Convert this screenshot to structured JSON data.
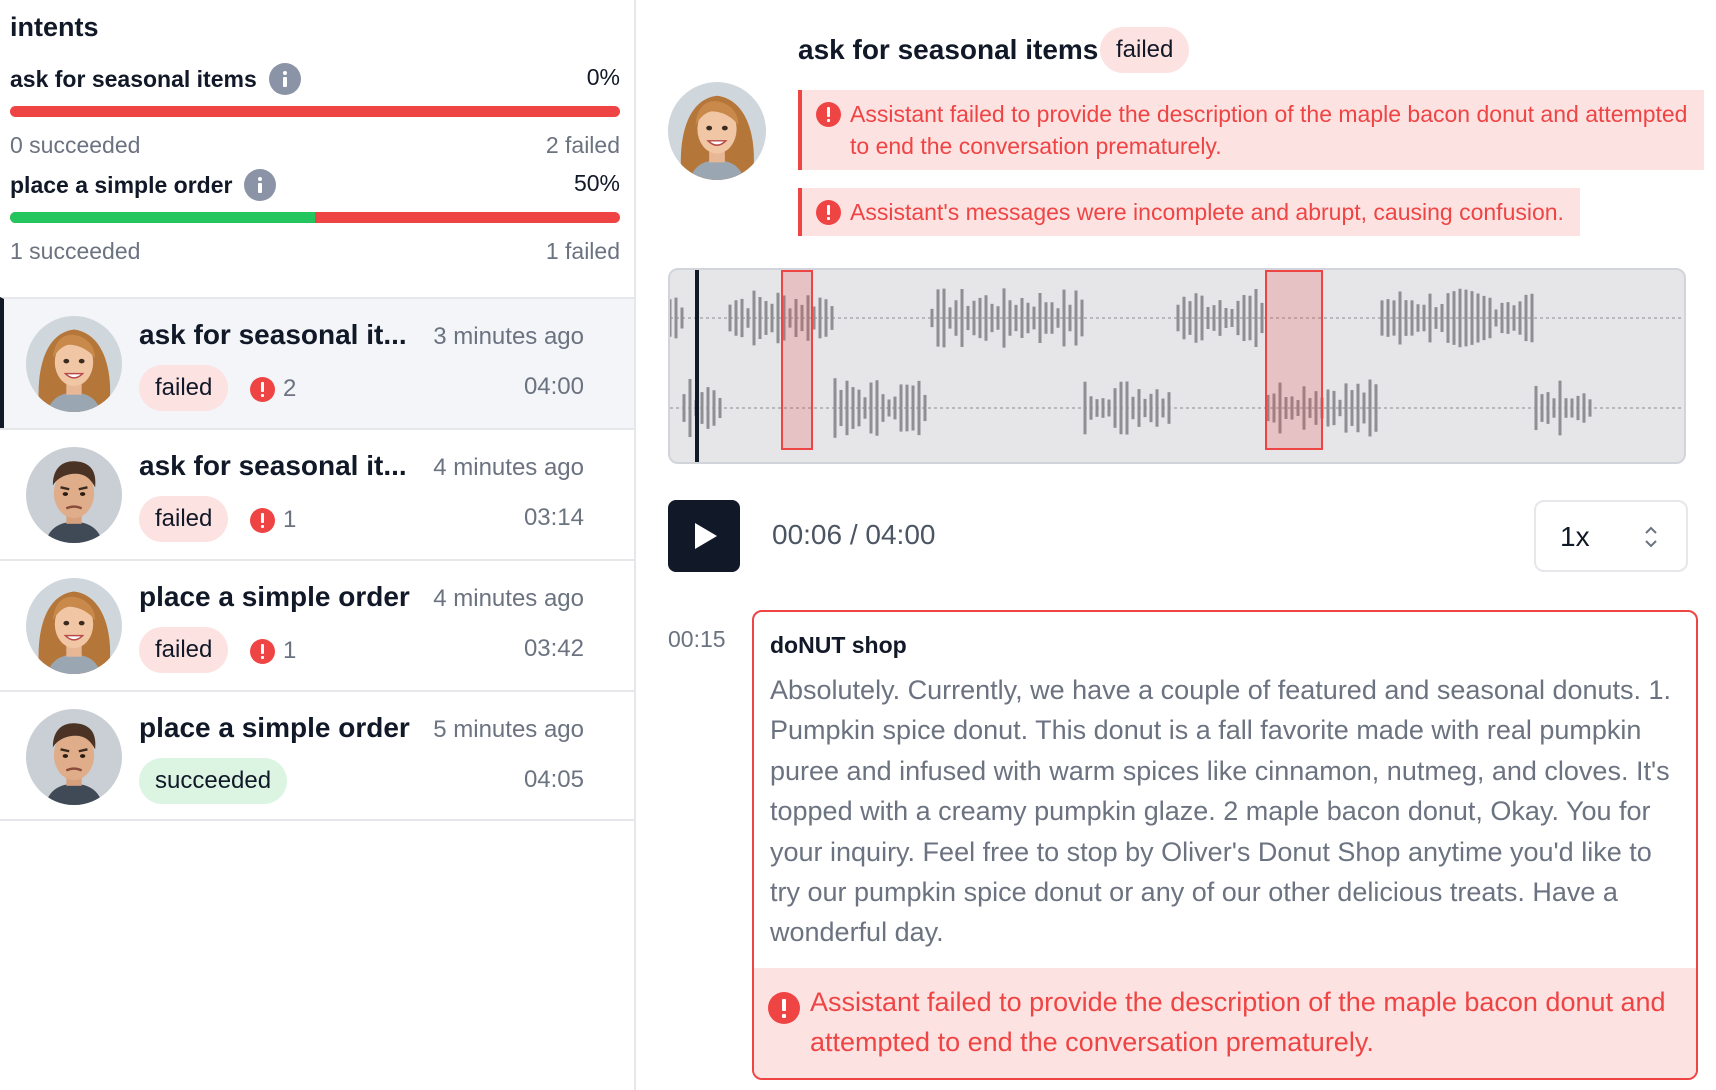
{
  "intents": {
    "title": "intents",
    "items": [
      {
        "name": "ask for seasonal items",
        "percent": "0%",
        "success_ratio": 0.0,
        "succeeded": "0 succeeded",
        "failed": "2 failed"
      },
      {
        "name": "place a simple order",
        "percent": "50%",
        "success_ratio": 0.5,
        "succeeded": "1 succeeded",
        "failed": "1 failed"
      }
    ]
  },
  "calls": [
    {
      "title": "ask for seasonal it...",
      "time_ago": "3 minutes ago",
      "status": "failed",
      "error_count": "2",
      "duration": "04:00",
      "avatar": "woman-avatar",
      "active": true
    },
    {
      "title": "ask for seasonal it...",
      "time_ago": "4 minutes ago",
      "status": "failed",
      "error_count": "1",
      "duration": "03:14",
      "avatar": "man-avatar",
      "active": false
    },
    {
      "title": "place a simple order",
      "time_ago": "4 minutes ago",
      "status": "failed",
      "error_count": "1",
      "duration": "03:42",
      "avatar": "woman-avatar",
      "active": false
    },
    {
      "title": "place a simple order",
      "time_ago": "5 minutes ago",
      "status": "succeeded",
      "error_count": "",
      "duration": "04:05",
      "avatar": "man-avatar",
      "active": false
    }
  ],
  "detail": {
    "title": "ask for seasonal items",
    "status": "failed",
    "issues": [
      "Assistant failed to provide the description of the maple bacon donut and attempted to end the conversation prematurely.",
      "Assistant's messages were incomplete and abrupt, causing confusion."
    ]
  },
  "player": {
    "current_time": "00:06",
    "total_time": "04:00",
    "readout": "00:06 / 04:00",
    "speed": "1x"
  },
  "transcript": {
    "timestamp": "00:15",
    "speaker": "doNUT shop",
    "text": "Absolutely. Currently, we have a couple of featured and seasonal donuts. 1. Pumpkin spice donut. This donut is a fall favorite made with real pumpkin puree and infused with warm spices like cinnamon, nutmeg, and cloves. It's topped with a creamy pumpkin glaze. 2 maple bacon donut, Okay. You for your inquiry. Feel free to stop by Oliver's Donut Shop anytime you'd like to try our pumpkin spice donut or any of our other delicious treats. Have a wonderful day.",
    "issue": "Assistant failed to provide the description of the maple bacon donut and attempted to end the conversation prematurely."
  },
  "colors": {
    "failed": "#ef4444",
    "succeeded": "#22c55e",
    "failed_bg": "#fde2e2",
    "succeeded_bg": "#dcf5e3",
    "dark": "#111827"
  }
}
